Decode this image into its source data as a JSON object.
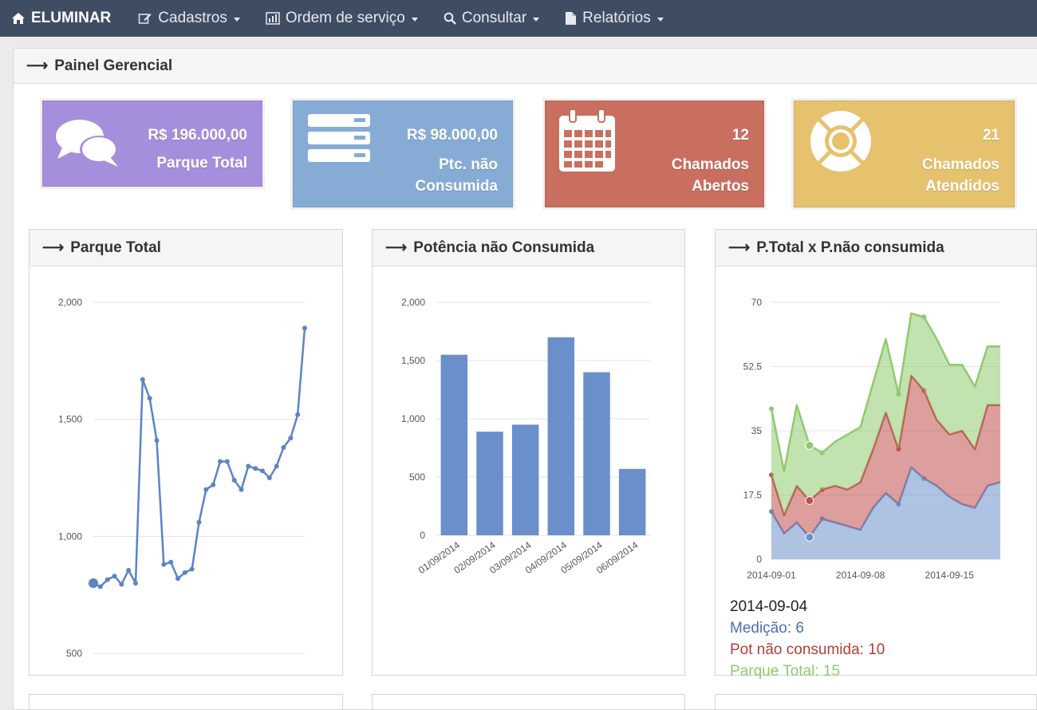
{
  "navbar": {
    "brand": "ELUMINAR",
    "items": [
      {
        "label": "Cadastros",
        "icon": "edit-icon"
      },
      {
        "label": "Ordem de serviço",
        "icon": "bar-chart-icon"
      },
      {
        "label": "Consultar",
        "icon": "search-icon"
      },
      {
        "label": "Relatórios",
        "icon": "document-icon"
      }
    ]
  },
  "page": {
    "title": "Painel Gerencial"
  },
  "stats": [
    {
      "value": "R$ 196.000,00",
      "label_lines": [
        "Parque Total"
      ],
      "color": "#a58fdc",
      "icon": "comments-icon"
    },
    {
      "value": "R$ 98.000,00",
      "label_lines": [
        "Ptc. não",
        "Consumida"
      ],
      "color": "#86acd6",
      "icon": "server-icon"
    },
    {
      "value": "12",
      "label_lines": [
        "Chamados",
        "Abertos"
      ],
      "color": "#c96f5f",
      "icon": "calendar-icon"
    },
    {
      "value": "21",
      "label_lines": [
        "Chamados",
        "Atendidos"
      ],
      "color": "#e6c16e",
      "icon": "life-ring-icon"
    }
  ],
  "panels": {
    "parque_total": "Parque Total",
    "potencia": "Potência não Consumida",
    "ptotal": "P.Total x P.não consumida"
  },
  "chart_data": [
    {
      "type": "line",
      "title": "Parque Total",
      "ylim": [
        500,
        2000
      ],
      "yticks": [
        "2,000",
        "1,500",
        "1,000",
        "500"
      ],
      "y_tick_values": [
        2000,
        1500,
        1000,
        500
      ],
      "values": [
        800,
        785,
        815,
        830,
        795,
        855,
        800,
        1670,
        1590,
        1410,
        880,
        890,
        820,
        845,
        860,
        1060,
        1200,
        1220,
        1320,
        1320,
        1240,
        1200,
        1300,
        1290,
        1280,
        1250,
        1300,
        1380,
        1420,
        1520,
        1890
      ],
      "color": "#5b84c4"
    },
    {
      "type": "bar",
      "title": "Potência não Consumida",
      "ylim": [
        0,
        2000
      ],
      "yticks": [
        "2,000",
        "1,500",
        "1,000",
        "500",
        "0"
      ],
      "y_tick_values": [
        2000,
        1500,
        1000,
        500,
        0
      ],
      "categories": [
        "01/09/2014",
        "02/09/2014",
        "03/09/2014",
        "04/09/2014",
        "05/09/2014",
        "06/09/2014"
      ],
      "values": [
        1550,
        890,
        950,
        1700,
        1400,
        570
      ],
      "color": "#6a8fca"
    },
    {
      "type": "area",
      "title": "P.Total x P.não consumida",
      "ylim": [
        0,
        70
      ],
      "yticks": [
        "70",
        "52.5",
        "35",
        "17.5",
        "0"
      ],
      "y_tick_values": [
        70,
        52.5,
        35,
        17.5,
        0
      ],
      "x": [
        "2014-09-01",
        "2014-09-02",
        "2014-09-03",
        "2014-09-04",
        "2014-09-05",
        "2014-09-06",
        "2014-09-07",
        "2014-09-08",
        "2014-09-09",
        "2014-09-10",
        "2014-09-11",
        "2014-09-12",
        "2014-09-13",
        "2014-09-14",
        "2014-09-15",
        "2014-09-16",
        "2014-09-17",
        "2014-09-18",
        "2014-09-19"
      ],
      "xticks": [
        "2014-09-01",
        "2014-09-08",
        "2014-09-15"
      ],
      "series": [
        {
          "name": "Medição",
          "color": "#6b8fc8",
          "values": [
            13,
            7,
            10,
            6,
            11,
            10,
            9,
            8,
            14,
            18,
            15,
            25,
            22,
            20,
            17,
            15,
            14,
            20,
            21
          ]
        },
        {
          "name": "Pot não consumida",
          "color": "#c0504d",
          "values": [
            10,
            5,
            10,
            10,
            8,
            10,
            10,
            13,
            16,
            22,
            15,
            25,
            24,
            18,
            17,
            20,
            16,
            22,
            21
          ]
        },
        {
          "name": "Parque Total",
          "color": "#8fca6e",
          "values": [
            18,
            12,
            22,
            15,
            10,
            12,
            15,
            15,
            18,
            20,
            15,
            17,
            20,
            22,
            19,
            18,
            17,
            16,
            16
          ]
        }
      ],
      "tooltip": {
        "date": "2014-09-04",
        "lines": [
          "Medição: 6",
          "Pot não consumida: 10",
          "Parque Total: 15"
        ],
        "colors": [
          "#4d6fb5",
          "#b03e3a",
          "#8fca6e"
        ]
      }
    }
  ]
}
